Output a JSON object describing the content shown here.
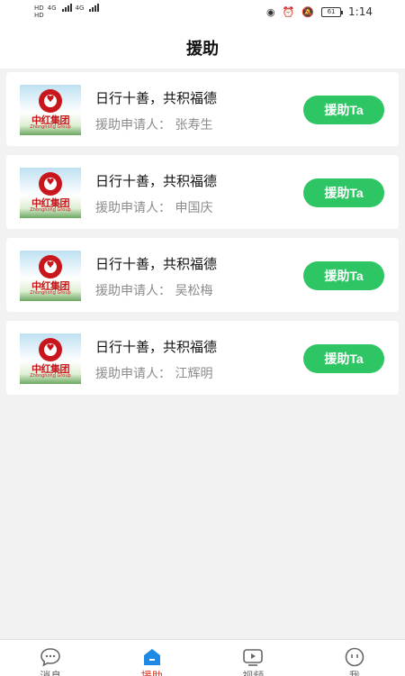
{
  "status_bar": {
    "net1": "4G",
    "net2": "4G",
    "battery": "61",
    "time": "1:14"
  },
  "header": {
    "title": "援助"
  },
  "help_list": [
    {
      "title": "日行十善，共积福德",
      "applicant": "援助申请人：  张寿生",
      "button": "援助Ta",
      "logo_text": "中红集团",
      "logo_sub": "Zhonghong Group"
    },
    {
      "title": "日行十善，共积福德",
      "applicant": "援助申请人：  申国庆",
      "button": "援助Ta",
      "logo_text": "中红集团",
      "logo_sub": "Zhonghong Group"
    },
    {
      "title": "日行十善，共积福德",
      "applicant": "援助申请人：  吴松梅",
      "button": "援助Ta",
      "logo_text": "中红集团",
      "logo_sub": "Zhonghong Group"
    },
    {
      "title": "日行十善，共积福德",
      "applicant": "援助申请人：  江辉明",
      "button": "援助Ta",
      "logo_text": "中红集团",
      "logo_sub": "Zhonghong Group"
    }
  ],
  "tab_bar": {
    "items": [
      {
        "label": "消息",
        "icon": "chat-icon"
      },
      {
        "label": "援助",
        "icon": "home-icon"
      },
      {
        "label": "视频",
        "icon": "video-icon"
      },
      {
        "label": "我",
        "icon": "face-icon"
      }
    ],
    "active_index": 1
  },
  "colors": {
    "accent_green": "#2ec564",
    "active_tab": "#d23a2a",
    "tab_icon_active": "#1e88e5",
    "brand_red": "#c9161d"
  }
}
